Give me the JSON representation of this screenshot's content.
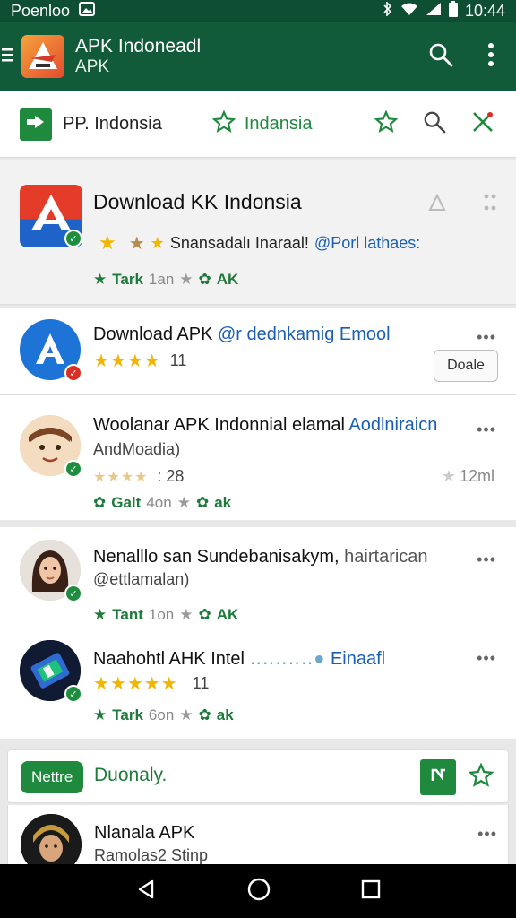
{
  "status": {
    "carrier": "Poenloo",
    "time": "10:44"
  },
  "appbar": {
    "title": "APK Indoneadl",
    "subtitle": "APK"
  },
  "filters": {
    "left": "PP. Indonsia",
    "middle": "Indansia"
  },
  "featured": {
    "title": "Download KK Indonsia",
    "subtitle": "Snansadalı Inaraal!",
    "subtitle_link": "@Porl lathaes:",
    "meta_label": "Tark",
    "meta_count": "1an",
    "meta_type": "AK"
  },
  "items": [
    {
      "title": "Download APK",
      "title_link": "@r dednkamig Emool",
      "rating_count": "11",
      "button": "Doale"
    },
    {
      "title": "Woolanar APK Indonnial elamal",
      "title_link": "Aodlniraicn",
      "subtitle": "AndMoadia)",
      "rating_count": ": 28",
      "size": "12ml",
      "meta_label": "Galt",
      "meta_count": "4on",
      "meta_type": "ak"
    },
    {
      "title": "Nenalllo san Sundebanisakym,",
      "title_grey": "hairtarican",
      "subtitle": "@ettlamalan)",
      "meta_label": "Tant",
      "meta_count": "1on",
      "meta_type": "AK"
    },
    {
      "title": "Naahohtl AHK Intel",
      "title_link": "Einaafl",
      "rating_count": "11",
      "meta_label": "Tark",
      "meta_count": "6on",
      "meta_type": "ak"
    }
  ],
  "section": {
    "pill": "Nettre",
    "title": "Duonaly."
  },
  "last_item": {
    "title": "Nlanala APK",
    "subtitle": "Ramolas2 Stinp"
  },
  "colors": {
    "primary": "#115a3a",
    "accent": "#1f8a3e",
    "star": "#f2b600",
    "link": "#1a5fb4"
  }
}
